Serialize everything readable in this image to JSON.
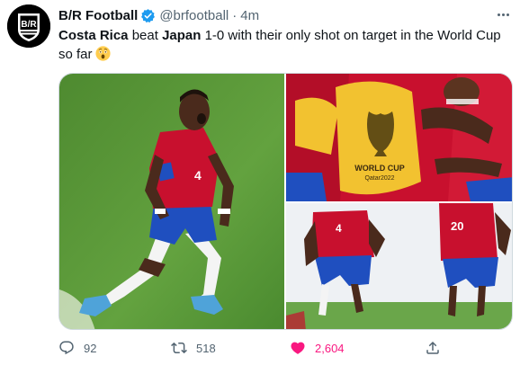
{
  "tweet": {
    "author": {
      "display_name": "B/R Football",
      "handle": "@brfootball",
      "verified": true,
      "avatar_text": "B/R"
    },
    "separator": "·",
    "time": "4m",
    "text": {
      "part1": "Costa Rica",
      "part2": " beat ",
      "part3": "Japan",
      "part4": " 1-0 with their only shot on target in the World Cup so far",
      "emoji": "astonished-face"
    },
    "media": [
      {
        "description": "Costa Rica player celebrating, number 4 red jersey",
        "jersey_number": "4"
      },
      {
        "description": "Players hugging, WORLD CUP Qatar2022 bib",
        "bib_text_1": "WORLD CUP",
        "bib_text_2": "Qatar2022"
      },
      {
        "description": "Two Costa Rica players running",
        "jersey_numbers": [
          "4",
          "20"
        ]
      }
    ],
    "stats": {
      "replies": "92",
      "retweets": "518",
      "likes": "2,604"
    },
    "liked": true
  },
  "colors": {
    "text": "#0f1419",
    "muted": "#536471",
    "verified": "#1d9bf0",
    "like": "#f91880",
    "jersey_red": "#c8102e",
    "shorts_blue": "#1f4fbf",
    "pitch_green": "#5f9a3c"
  },
  "icons": {
    "reply": "reply-icon",
    "retweet": "retweet-icon",
    "like": "heart-icon",
    "share": "share-icon",
    "more": "more-icon",
    "verified": "verified-badge-icon"
  }
}
